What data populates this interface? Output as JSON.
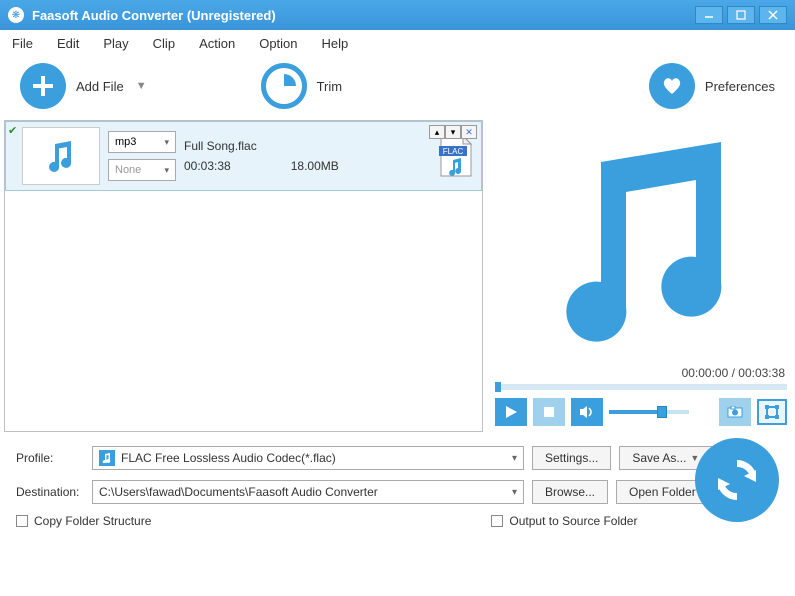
{
  "window": {
    "title": "Faasoft Audio Converter (Unregistered)"
  },
  "menu": {
    "file": "File",
    "edit": "Edit",
    "play": "Play",
    "clip": "Clip",
    "action": "Action",
    "option": "Option",
    "help": "Help"
  },
  "toolbar": {
    "addfile": "Add File",
    "trim": "Trim",
    "preferences": "Preferences"
  },
  "file": {
    "format_sel": "mp3",
    "effect_sel": "None",
    "name": "Full Song.flac",
    "duration": "00:03:38",
    "size": "18.00MB",
    "badge": "FLAC"
  },
  "preview": {
    "time": "00:00:00 / 00:03:38"
  },
  "profile": {
    "label": "Profile:",
    "value": "FLAC Free Lossless Audio Codec(*.flac)",
    "settings": "Settings...",
    "saveas": "Save As..."
  },
  "destination": {
    "label": "Destination:",
    "value": "C:\\Users\\fawad\\Documents\\Faasoft Audio Converter",
    "browse": "Browse...",
    "open": "Open Folder"
  },
  "checks": {
    "copy_structure": "Copy Folder Structure",
    "output_src": "Output to Source Folder"
  }
}
